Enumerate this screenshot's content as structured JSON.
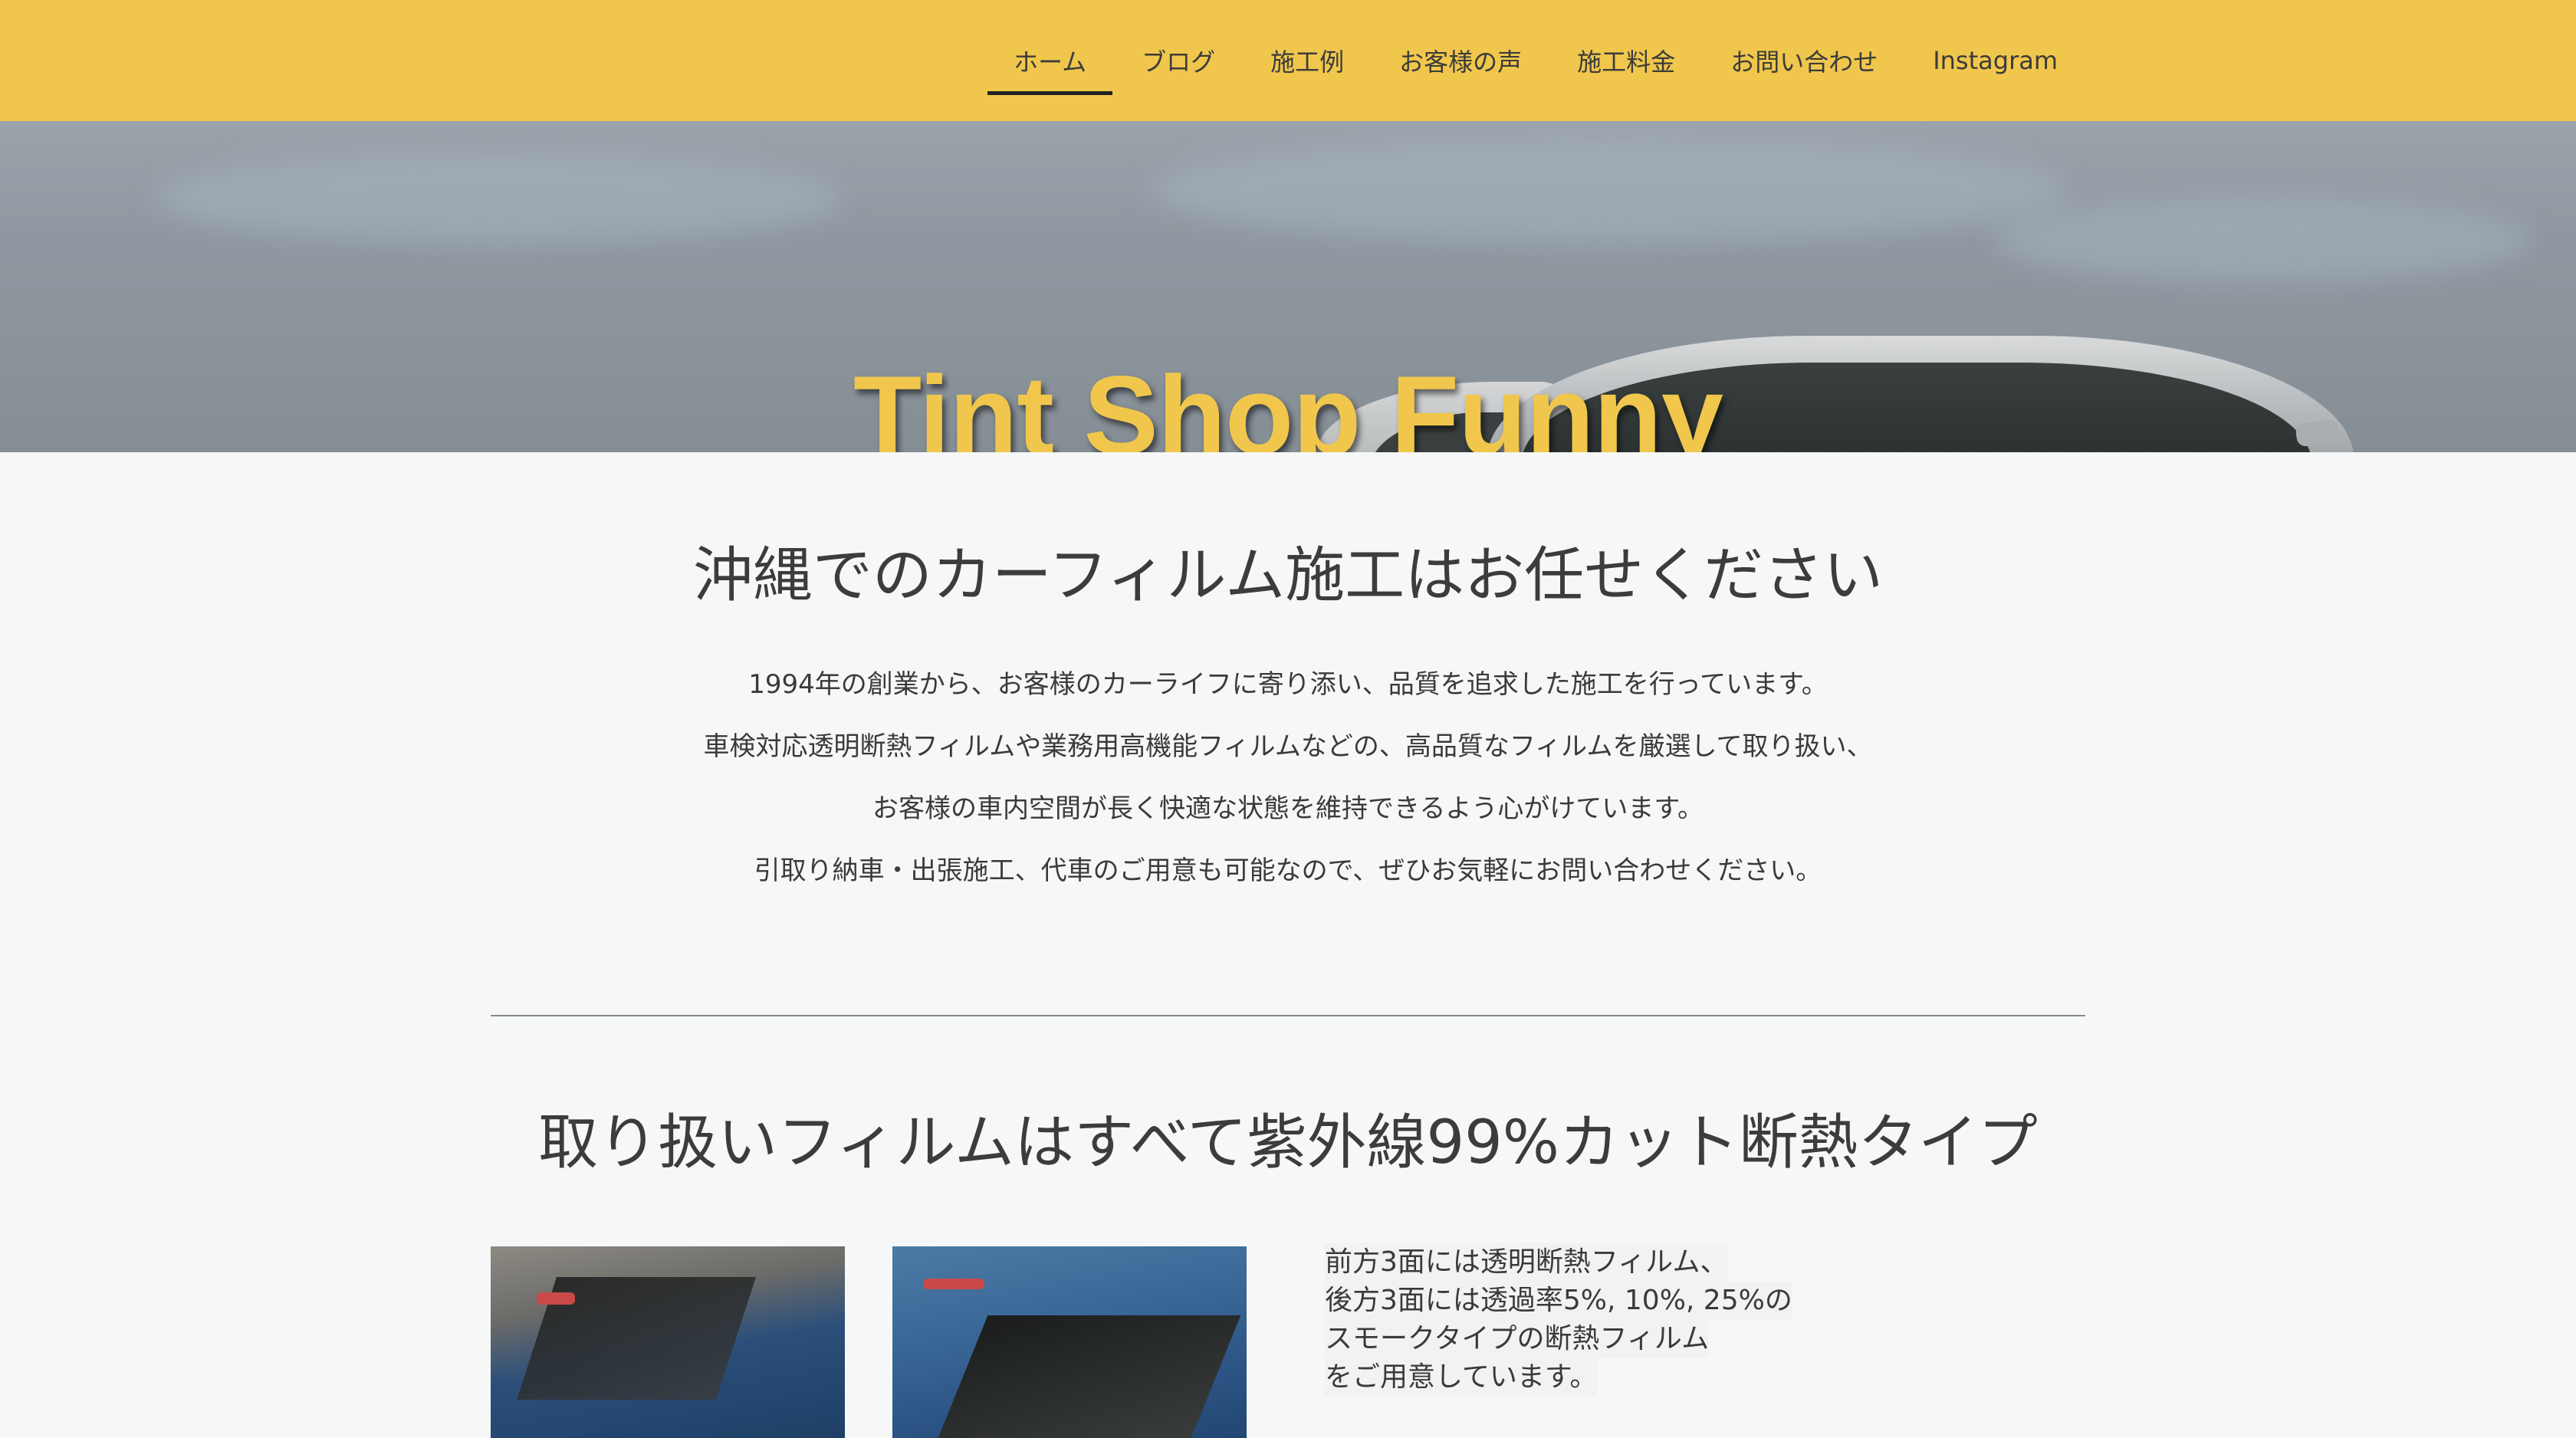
{
  "nav": {
    "items": [
      {
        "label": "ホーム",
        "active": true
      },
      {
        "label": "ブログ"
      },
      {
        "label": "施工例"
      },
      {
        "label": "お客様の声"
      },
      {
        "label": "施工料金"
      },
      {
        "label": "お問い合わせ"
      },
      {
        "label": "Instagram"
      }
    ],
    "bar_color": "#f0c74c"
  },
  "hero": {
    "title": "Tint Shop Funny"
  },
  "intro": {
    "title": "沖縄でのカーフィルム施工はお任せください",
    "lines": [
      "1994年の創業から、お客様のカーライフに寄り添い、品質を追求した施工を行っています。",
      "車検対応透明断熱フィルムや業務用高機能フィルムなどの、高品質なフィルムを厳選して取り扱い、",
      "お客様の車内空間が長く快適な状態を維持できるよう心がけています。",
      "引取り納車・出張施工、代車のご用意も可能なので、ぜひお気軽にお問い合わせください。"
    ]
  },
  "films": {
    "title": "取り扱いフィルムはすべて紫外線99%カット断熱タイプ",
    "text_lines": [
      "前方3面には透明断熱フィルム、",
      "後方3面には透過率5%, 10%, 25%の",
      "スモークタイプの断熱フィルム",
      "をご用意しています。"
    ]
  }
}
